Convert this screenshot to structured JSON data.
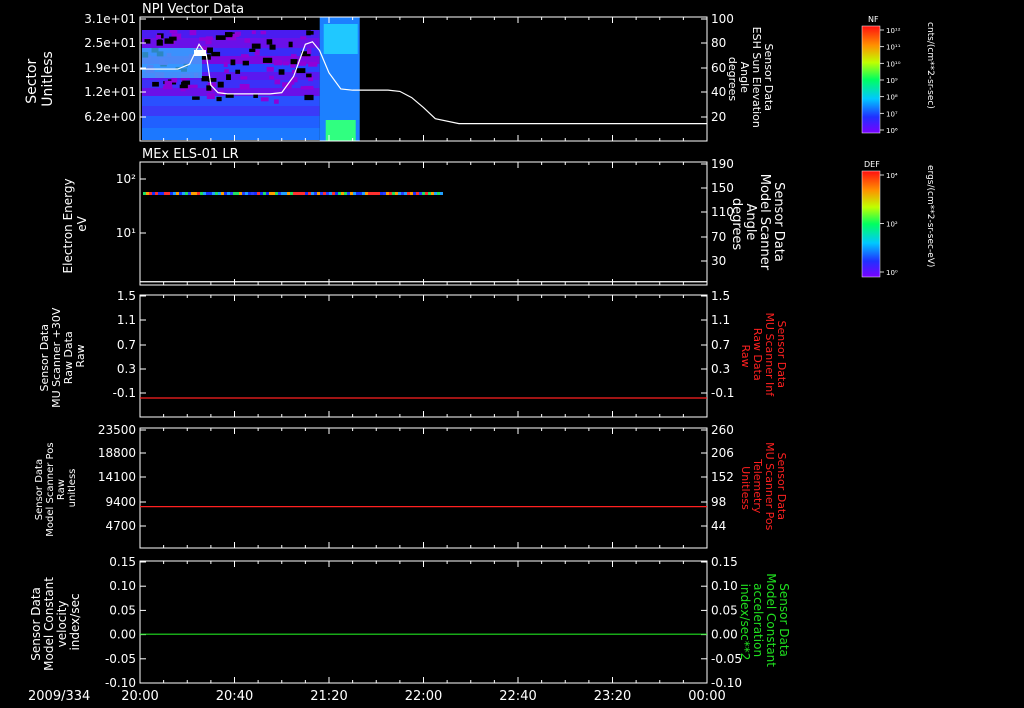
{
  "colors": {
    "background": "#000000",
    "frame": "#ffffff",
    "text": "#ffffff",
    "red_series": "#ff2020",
    "green_series": "#20e020",
    "white_series": "#ffffff"
  },
  "time_axis": {
    "start_label": "2009/334",
    "ticks": [
      "20:00",
      "20:40",
      "21:20",
      "22:00",
      "22:40",
      "23:20",
      "00:00"
    ],
    "minutes": [
      0,
      40,
      80,
      120,
      160,
      200,
      240
    ]
  },
  "colorbars": [
    {
      "title": "NF",
      "unit": "cnts/(cm**2-sr-sec)",
      "tick_labels": [
        "10¹²",
        "10¹¹",
        "10¹⁰",
        "10⁹",
        "10⁸",
        "10⁷",
        "10⁶"
      ]
    },
    {
      "title": "DEF",
      "unit": "ergs/(cm**2-sr-sec-eV)",
      "tick_labels": [
        "10⁴",
        "10²",
        "10⁰"
      ]
    }
  ],
  "chart_data": [
    {
      "type": "heatmap",
      "title": "NPI Vector Data",
      "ylabel": [
        "Sector",
        "Unitless"
      ],
      "yticks": [
        "3.1e+01",
        "2.5e+01",
        "1.9e+01",
        "1.2e+01",
        "6.2e+00"
      ],
      "right_ylabel": [
        "Sensor Data",
        "ESH Sun Elevation",
        "Angle",
        "degrees"
      ],
      "right_yticks": [
        "100",
        "80",
        "60",
        "40",
        "20"
      ],
      "right_ylim": [
        0,
        100
      ],
      "heatmap_extent_minutes": [
        0,
        93
      ],
      "overlay_line": {
        "name": "ESH Sun Elevation Angle",
        "color": "#ffffff",
        "x_minutes": [
          0,
          8,
          16,
          21,
          25,
          28,
          30,
          33,
          37,
          45,
          55,
          60,
          65,
          70,
          73,
          76,
          80,
          85,
          90,
          95,
          100,
          105,
          110,
          115,
          120,
          125,
          135,
          240
        ],
        "y": [
          58,
          58,
          58,
          62,
          78,
          70,
          45,
          39,
          38,
          38,
          38,
          39,
          52,
          78,
          80,
          73,
          55,
          42,
          41,
          41,
          41,
          41,
          40,
          35,
          27,
          18,
          14,
          14
        ]
      }
    },
    {
      "type": "heatmap",
      "title": "MEx ELS-01 LR",
      "ylabel": [
        "Electron Energy",
        "eV"
      ],
      "yticks": [
        "10²",
        "10¹"
      ],
      "yscale": "log",
      "right_ylabel": [
        "Sensor Data",
        "Model Scanner",
        "Angle",
        "degrees"
      ],
      "right_yticks": [
        "190",
        "150",
        "110",
        "70",
        "30"
      ],
      "right_ylim": [
        0,
        190
      ],
      "band_extent_minutes": [
        0,
        128
      ],
      "overlay_line": {
        "name": "Model Scanner Angle",
        "color": "#ffffff",
        "x_minutes": [
          0,
          240
        ],
        "y": [
          5,
          5
        ]
      }
    },
    {
      "type": "line",
      "ylabel": [
        "Sensor Data",
        "MU Scanner +30V",
        "Raw Data",
        "Raw"
      ],
      "yticks": [
        "1.5",
        "1.1",
        "0.7",
        "0.3",
        "-0.1"
      ],
      "ylim": [
        -0.3,
        1.5
      ],
      "right_ylabel": [
        "Sensor Data",
        "MU Scanner Inf",
        "Raw Data",
        "Raw"
      ],
      "right_yticks": [
        "1.5",
        "1.1",
        "0.7",
        "0.3",
        "-0.1"
      ],
      "series": [
        {
          "color": "#ff2020",
          "x_minutes": [
            0,
            240
          ],
          "y": [
            -0.02,
            -0.02
          ]
        }
      ]
    },
    {
      "type": "line",
      "ylabel": [
        "Sensor Data",
        "Model Scanner Pos",
        "Raw",
        "unitless"
      ],
      "yticks": [
        "23500",
        "18800",
        "14100",
        "9400",
        "4700"
      ],
      "ylim": [
        0,
        23500
      ],
      "right_ylabel": [
        "Sensor Data",
        "MU Scanner Pos",
        "Telemetry",
        "Unitless"
      ],
      "right_yticks": [
        "260",
        "206",
        "152",
        "98",
        "44"
      ],
      "series": [
        {
          "color": "#ff2020",
          "x_minutes": [
            0,
            240
          ],
          "y": [
            8100,
            8100
          ]
        }
      ]
    },
    {
      "type": "line",
      "ylabel": [
        "Sensor Data",
        "Model Constant",
        "velocity",
        "index/sec"
      ],
      "yticks": [
        "0.15",
        "0.10",
        "0.05",
        "0.00",
        "-0.05",
        "-0.10"
      ],
      "ylim": [
        -0.1,
        0.15
      ],
      "right_ylabel": [
        "Sensor Data",
        "Model Constant",
        "acceleration",
        "index/sec**2"
      ],
      "right_yticks": [
        "0.15",
        "0.10",
        "0.05",
        "0.00",
        "-0.05",
        "-0.10"
      ],
      "series": [
        {
          "color": "#20e020",
          "x_minutes": [
            0,
            240
          ],
          "y": [
            0.0,
            0.0
          ]
        }
      ]
    }
  ]
}
